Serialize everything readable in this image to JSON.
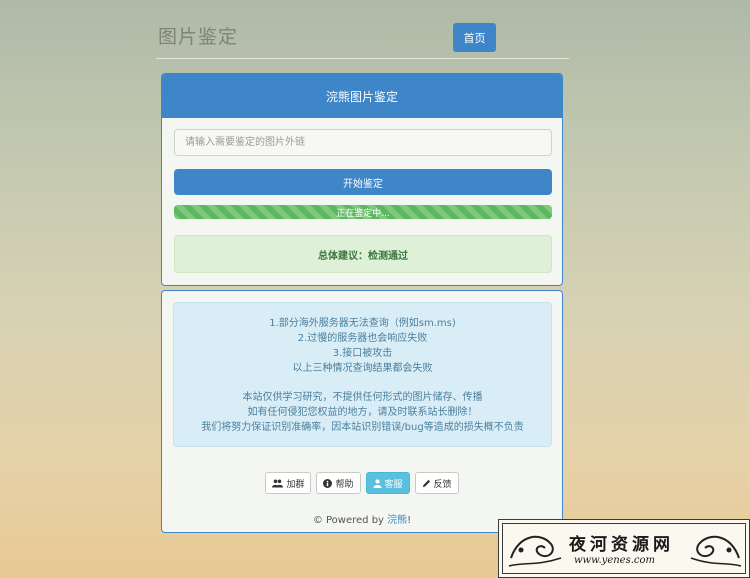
{
  "header": {
    "brand": "图片鉴定",
    "home_button": "首页"
  },
  "checker": {
    "title": "浣熊图片鉴定",
    "input_placeholder": "请输入需要鉴定的图片外链",
    "start_button": "开始鉴定",
    "progress_text": "正在鉴定中...",
    "progress_value": 1.0,
    "result": "总体建议：检测通过"
  },
  "notice": {
    "lines_group1": [
      "1.部分海外服务器无法查询（例如sm.ms)",
      "2.过慢的服务器也会响应失败",
      "3.接口被攻击",
      "以上三种情况查询结果都会失败"
    ],
    "lines_group2": [
      "本站仅供学习研究，不提供任何形式的图片储存、传播",
      "如有任何侵犯您权益的地方，请及时联系站长删除！",
      "我们将努力保证识别准确率，因本站识别错误/bug等造成的损失概不负责"
    ]
  },
  "actions": [
    {
      "label": "加群",
      "icon": "users-icon"
    },
    {
      "label": "帮助",
      "icon": "info-circle-icon"
    },
    {
      "label": "客服",
      "icon": "user-icon",
      "active": true
    },
    {
      "label": "反馈",
      "icon": "pencil-icon"
    }
  ],
  "footer": {
    "prefix": "© Powered by ",
    "author": "浣熊",
    "suffix": "!"
  },
  "watermark": {
    "title": "夜河资源网",
    "url": "www.yenes.com"
  },
  "colors": {
    "primary": "#3f86c8",
    "success": "#5cb85c",
    "info": "#5bc0de"
  }
}
